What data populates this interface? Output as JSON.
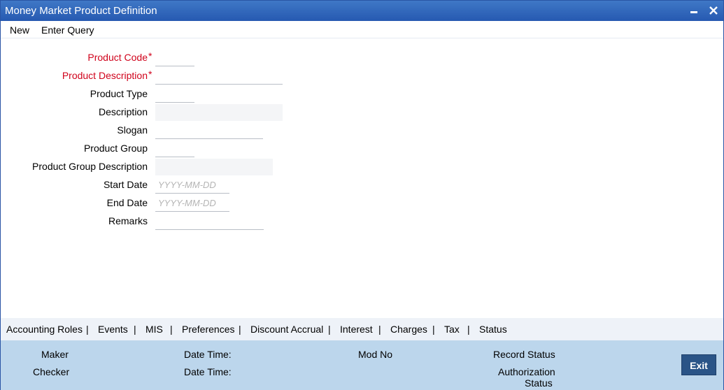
{
  "window": {
    "title": "Money Market Product Definition"
  },
  "toolbar": {
    "new_label": "New",
    "enter_query_label": "Enter Query"
  },
  "form": {
    "required_marker": "*",
    "product_code": {
      "label": "Product Code",
      "value": "",
      "required": true
    },
    "product_description": {
      "label": "Product Description",
      "value": "",
      "required": true
    },
    "product_type": {
      "label": "Product Type",
      "value": ""
    },
    "description": {
      "label": "Description",
      "value": ""
    },
    "slogan": {
      "label": "Slogan",
      "value": ""
    },
    "product_group": {
      "label": "Product Group",
      "value": ""
    },
    "product_group_description": {
      "label": "Product Group Description",
      "value": ""
    },
    "start_date": {
      "label": "Start Date",
      "value": "",
      "placeholder": "YYYY-MM-DD"
    },
    "end_date": {
      "label": "End Date",
      "value": "",
      "placeholder": "YYYY-MM-DD"
    },
    "remarks": {
      "label": "Remarks",
      "value": ""
    }
  },
  "tabs": {
    "separator": "|",
    "items": [
      "Accounting Roles",
      "Events",
      "MIS",
      "Preferences",
      "Discount Accrual",
      "Interest",
      "Charges",
      "Tax",
      "Status"
    ]
  },
  "footer": {
    "maker": "Maker",
    "checker": "Checker",
    "maker_date_time": "Date Time:",
    "checker_date_time": "Date Time:",
    "mod_no": "Mod No",
    "record_status": "Record Status",
    "authorization_status_1": "Authorization",
    "authorization_status_2": "Status",
    "exit_label": "Exit"
  },
  "colors": {
    "titlebar": "#2659b1",
    "required_label": "#d0021b",
    "footer_bg": "#bcd6ec",
    "exit_button": "#2a5487"
  }
}
